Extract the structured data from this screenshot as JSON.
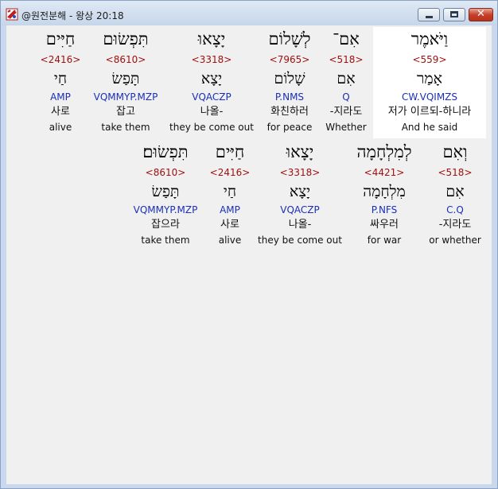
{
  "window": {
    "title": "@원전분해 - 왕상 20:18"
  },
  "rows": [
    {
      "words": [
        {
          "hebrew": "וַיֹּאמֶר",
          "strong": "<559>",
          "lexeme": "אָמַר",
          "parsing": "CW.VQIMZS",
          "korean": "저가 이르되-하니라",
          "english": "And he said",
          "selected": true
        },
        {
          "hebrew": "אִם־",
          "strong": "<518>",
          "lexeme": "אִם",
          "parsing": "Q",
          "korean": "-지라도",
          "english": "Whether"
        },
        {
          "hebrew": "לְשָׁלוֹם",
          "strong": "<7965>",
          "lexeme": "שָׁלוֹם",
          "parsing": "P.NMS",
          "korean": "화친하러",
          "english": "for peace"
        },
        {
          "hebrew": "יָצָאוּ",
          "strong": "<3318>",
          "lexeme": "יָצָא",
          "parsing": "VQACZP",
          "korean": "나올-",
          "english": "they be come out"
        },
        {
          "hebrew": "תִּפְשׂוּם",
          "strong": "<8610>",
          "lexeme": "תָּפַשׂ",
          "parsing": "VQMMYP.MZP",
          "korean": "잡고",
          "english": "take them"
        },
        {
          "hebrew": "חַיִּים",
          "strong": "<2416>",
          "lexeme": "חַי",
          "parsing": "AMP",
          "korean": "사로",
          "english": "alive"
        }
      ]
    },
    {
      "words": [
        {
          "hebrew": "וְאִם",
          "strong": "<518>",
          "lexeme": "אִם",
          "parsing": "C.Q",
          "korean": "-지라도",
          "english": "or whether"
        },
        {
          "hebrew": "לְמִלְחָמָה",
          "strong": "<4421>",
          "lexeme": "מִלְחָמָה",
          "parsing": "P.NFS",
          "korean": "싸우러",
          "english": "for war"
        },
        {
          "hebrew": "יָצָאוּ",
          "strong": "<3318>",
          "lexeme": "יָצָא",
          "parsing": "VQACZP",
          "korean": "나올-",
          "english": "they be come out"
        },
        {
          "hebrew": "חַיִּים",
          "strong": "<2416>",
          "lexeme": "חַי",
          "parsing": "AMP",
          "korean": "사로",
          "english": "alive"
        },
        {
          "hebrew": "תִּפְשׂוּם׃",
          "strong": "<8610>",
          "lexeme": "תָּפַשׂ",
          "parsing": "VQMMYP.MZP",
          "korean": "잡으라",
          "english": "take them"
        }
      ]
    }
  ]
}
